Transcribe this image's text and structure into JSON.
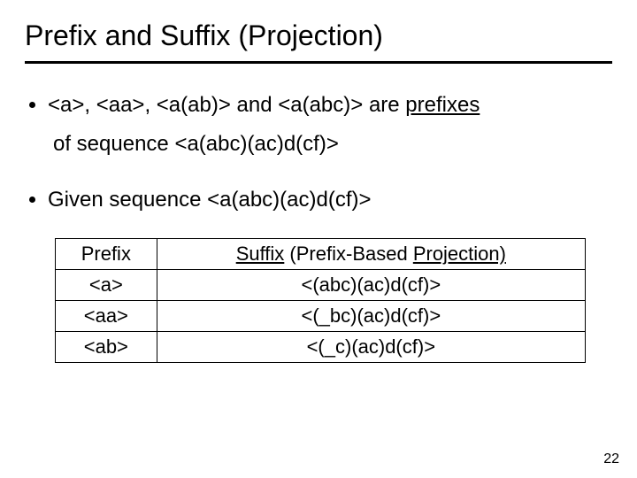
{
  "title": "Prefix and Suffix (Projection)",
  "bullets": {
    "b1_pre": "<a>, <aa>, <a(ab)> and <a(abc)> are ",
    "b1_under": "prefixes",
    "b1_post_line2": "of sequence <a(abc)(ac)d(cf)>",
    "b2": "Given sequence <a(abc)(ac)d(cf)>"
  },
  "table": {
    "header": {
      "prefix": "Prefix",
      "suffix_u1": "Suffix",
      "suffix_mid": " (Prefix-Based ",
      "suffix_u2": "Projection)"
    },
    "rows": [
      {
        "prefix": "<a>",
        "suffix": "<(abc)(ac)d(cf)>"
      },
      {
        "prefix": "<aa>",
        "suffix": "<(_bc)(ac)d(cf)>"
      },
      {
        "prefix": "<ab>",
        "suffix": "<(_c)(ac)d(cf)>"
      }
    ]
  },
  "page_number": "22"
}
